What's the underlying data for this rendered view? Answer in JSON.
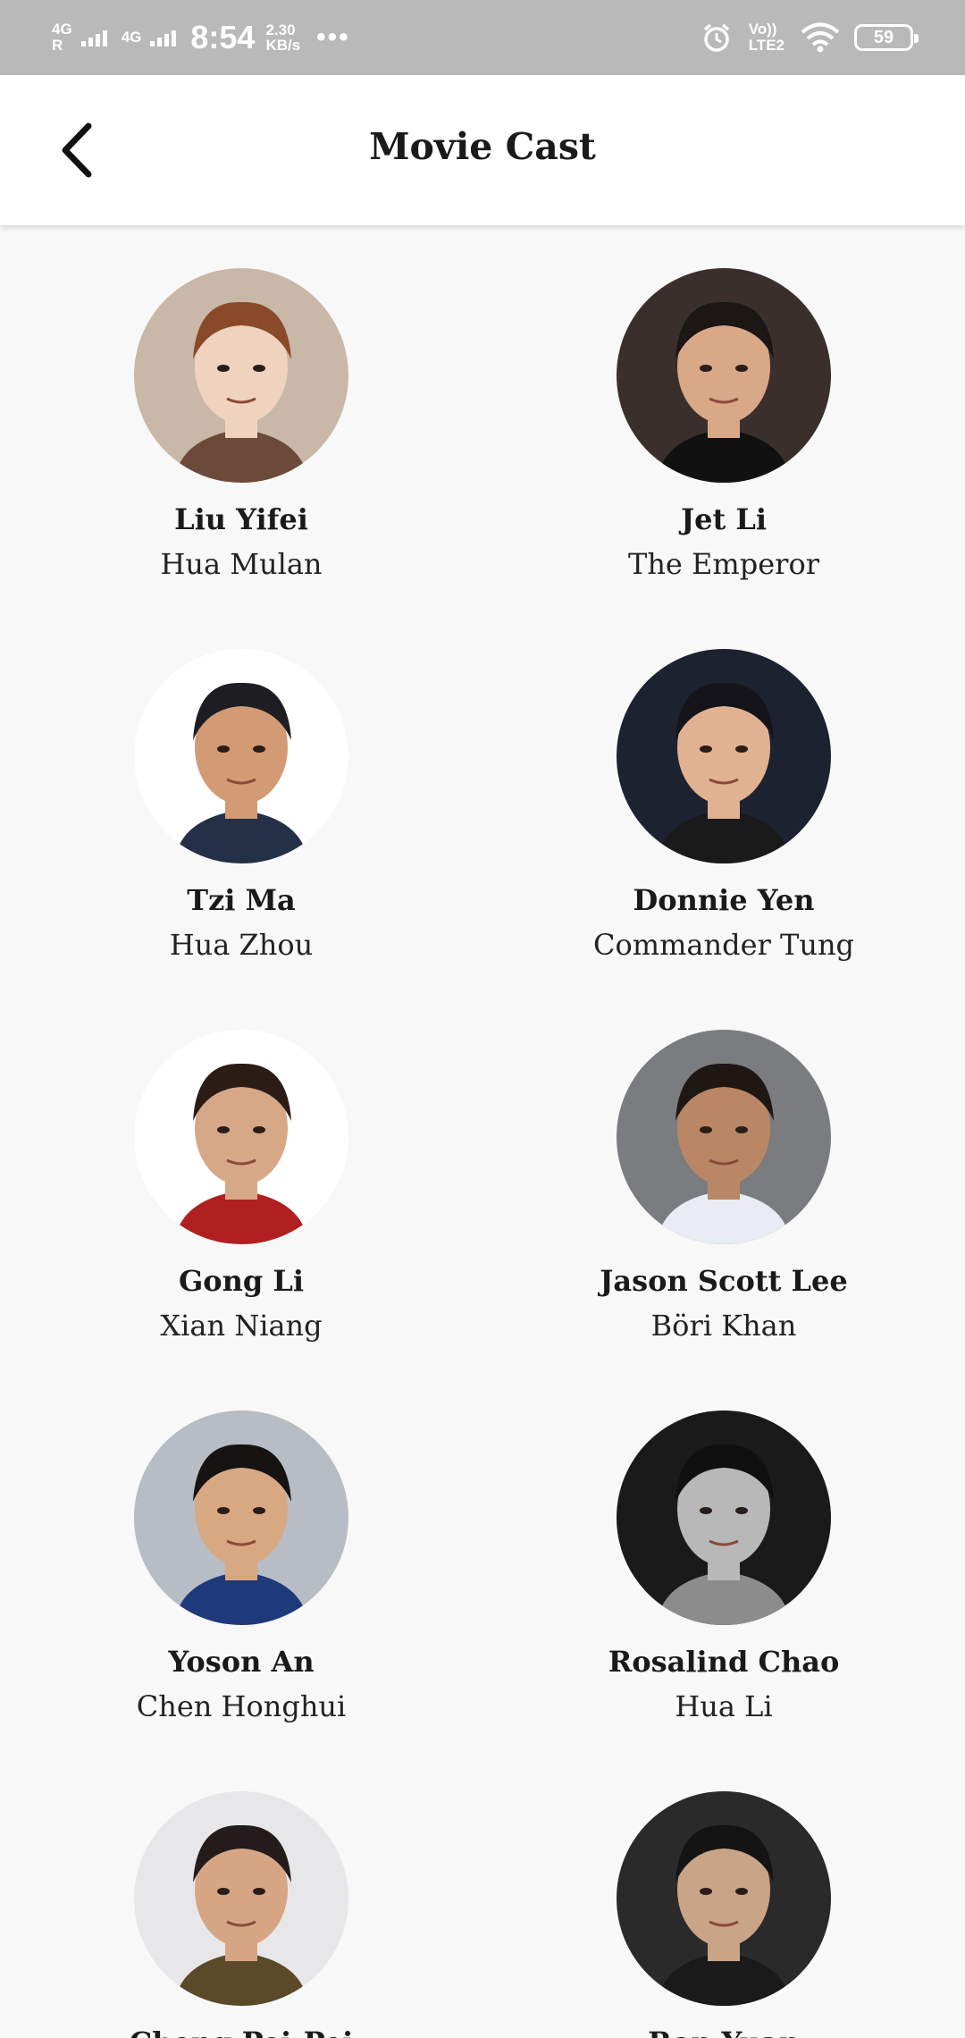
{
  "status_bar": {
    "network_1": "4G",
    "network_1_sub": "R",
    "network_2": "4G",
    "time": "8:54",
    "speed_value": "2.30",
    "speed_unit": "KB/s",
    "more": "•••",
    "volte_top": "Vo))",
    "volte_bottom": "LTE2",
    "battery": "59"
  },
  "header": {
    "title": "Movie Cast",
    "back_icon": "chevron-left-icon"
  },
  "cast": [
    {
      "actor": "Liu Yifei",
      "character": "Hua Mulan",
      "bg": "#c9b8a8",
      "skin": "#efd3bf",
      "hair": "#8a4a2a",
      "shirt": "#6b4a3a"
    },
    {
      "actor": "Jet Li",
      "character": "The Emperor",
      "bg": "#3a2f2c",
      "skin": "#d9a887",
      "hair": "#1c1614",
      "shirt": "#111111"
    },
    {
      "actor": "Tzi Ma",
      "character": "Hua Zhou",
      "bg": "#ffffff",
      "skin": "#d39b74",
      "hair": "#1e1e22",
      "shirt": "#233048"
    },
    {
      "actor": "Donnie Yen",
      "character": "Commander Tung",
      "bg": "#1d2230",
      "skin": "#e1b291",
      "hair": "#14141a",
      "shirt": "#1a1a1a"
    },
    {
      "actor": "Gong Li",
      "character": "Xian Niang",
      "bg": "#ffffff",
      "skin": "#d7a887",
      "hair": "#2b1c16",
      "shirt": "#b02020"
    },
    {
      "actor": "Jason Scott Lee",
      "character": "Böri Khan",
      "bg": "#7a7c80",
      "skin": "#b98766",
      "hair": "#1e1714",
      "shirt": "#e9ecf2"
    },
    {
      "actor": "Yoson An",
      "character": "Chen Honghui",
      "bg": "#b8bcc4",
      "skin": "#d8a883",
      "hair": "#161312",
      "shirt": "#1e3a7a"
    },
    {
      "actor": "Rosalind Chao",
      "character": "Hua Li",
      "bg": "#1a1a1a",
      "skin": "#b8b8b8",
      "hair": "#101010",
      "shirt": "#8c8c8c"
    },
    {
      "actor": "Cheng Pei-Pei",
      "character": "",
      "bg": "#e7e7e9",
      "skin": "#d6a684",
      "hair": "#241c1a",
      "shirt": "#5a4a2a"
    },
    {
      "actor": "Ron Yuan",
      "character": "",
      "bg": "#2a2a2a",
      "skin": "#caa487",
      "hair": "#141414",
      "shirt": "#1a1a1a"
    }
  ]
}
